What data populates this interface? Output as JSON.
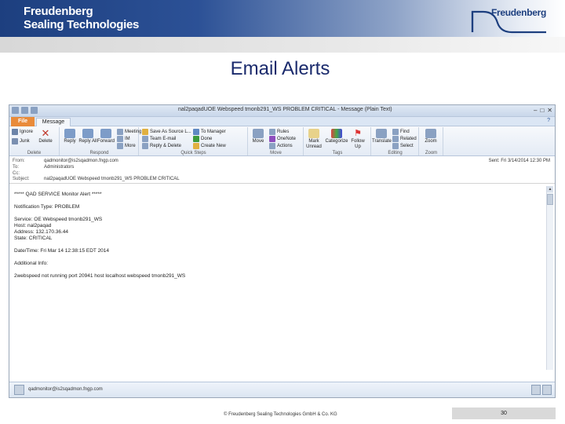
{
  "brand": {
    "left_line1": "Freudenberg",
    "left_line2": "Sealing Technologies",
    "right_logo": "Freudenberg"
  },
  "slide": {
    "title": "Email Alerts"
  },
  "window": {
    "title": "nal2paqadUOE Webspeed tmonb291_WS PROBLEM CRITICAL - Message (Plain Text)",
    "tabs": {
      "file": "File",
      "message": "Message"
    },
    "ribbon": {
      "delete_group": {
        "ignore": "Ignore",
        "junk": "Junk",
        "delete": "Delete",
        "label": "Delete"
      },
      "respond_group": {
        "reply": "Reply",
        "reply_all": "Reply All",
        "forward": "Forward",
        "meeting": "Meeting",
        "im": "IM",
        "more": "More",
        "label": "Respond"
      },
      "quicksteps_group": {
        "save_as_source": "Save As Source L...",
        "team_email": "Team E-mail",
        "reply_delete": "Reply & Delete",
        "to_manager": "To Manager",
        "done": "Done",
        "create_new": "Create New",
        "label": "Quick Steps"
      },
      "move_group": {
        "move": "Move",
        "rules": "Rules",
        "onenote": "OneNote",
        "actions": "Actions",
        "label": "Move"
      },
      "tags_group": {
        "mark_unread": "Mark Unread",
        "categorize": "Categorize",
        "follow_up": "Follow Up",
        "label": "Tags"
      },
      "editing_group": {
        "translate": "Translate",
        "find": "Find",
        "related": "Related",
        "select": "Select",
        "label": "Editing"
      },
      "zoom_group": {
        "zoom": "Zoom",
        "label": "Zoom"
      }
    },
    "header": {
      "from_label": "From:",
      "from_value": "qadmonitor@is2sqadmon.fngp.com",
      "to_label": "To:",
      "to_value": "Administrators",
      "cc_label": "Cc:",
      "cc_value": "",
      "subject_label": "Subject:",
      "subject_value": "nal2paqadUOE Webspeed tmonb291_WS PROBLEM CRITICAL",
      "sent_label": "Sent:",
      "sent_value": "Fri 3/14/2014 12:30 PM"
    },
    "body_lines": [
      "***** QAD SERVICE Monitor Alert *****",
      "",
      "Notification Type: PROBLEM",
      "",
      "Service: OE Webspeed tmonb291_WS",
      "Host: nal2paqad",
      "Address: 132.170.36.44",
      "State: CRITICAL",
      "",
      "Date/Time: Fri Mar 14 12:38:15 EDT 2014",
      "",
      "Additional Info:",
      "",
      "2webspeed not running port 20941 host localhost webspeed tmonb291_WS"
    ],
    "people_pane": {
      "address": "qadmonitor@is2sqadmon.fngp.com"
    }
  },
  "footer": {
    "copyright": "© Freudenberg Sealing Technologies GmbH & Co. KG",
    "page_number": "30"
  },
  "colors": {
    "banner_dark": "#1d3f7f",
    "title_blue": "#1a2a6c",
    "file_tab": "#e98b3a"
  }
}
